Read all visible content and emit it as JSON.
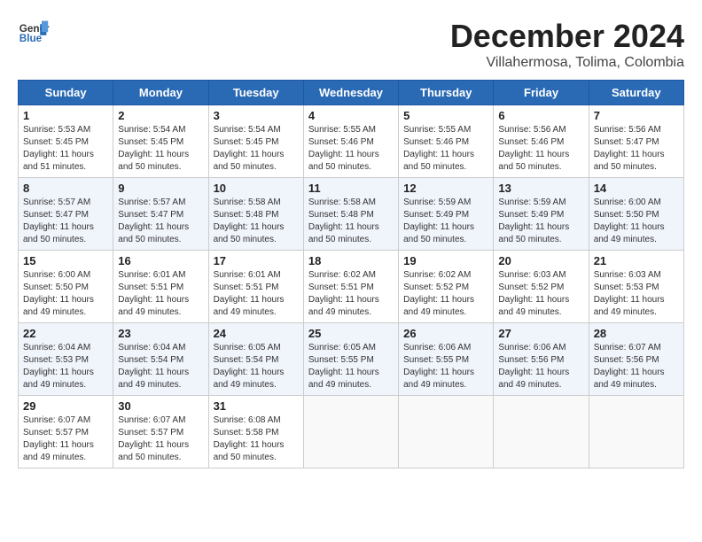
{
  "header": {
    "logo_line1": "General",
    "logo_line2": "Blue",
    "month": "December 2024",
    "location": "Villahermosa, Tolima, Colombia"
  },
  "days_of_week": [
    "Sunday",
    "Monday",
    "Tuesday",
    "Wednesday",
    "Thursday",
    "Friday",
    "Saturday"
  ],
  "weeks": [
    [
      {
        "day": 1,
        "info": "Sunrise: 5:53 AM\nSunset: 5:45 PM\nDaylight: 11 hours\nand 51 minutes."
      },
      {
        "day": 2,
        "info": "Sunrise: 5:54 AM\nSunset: 5:45 PM\nDaylight: 11 hours\nand 50 minutes."
      },
      {
        "day": 3,
        "info": "Sunrise: 5:54 AM\nSunset: 5:45 PM\nDaylight: 11 hours\nand 50 minutes."
      },
      {
        "day": 4,
        "info": "Sunrise: 5:55 AM\nSunset: 5:46 PM\nDaylight: 11 hours\nand 50 minutes."
      },
      {
        "day": 5,
        "info": "Sunrise: 5:55 AM\nSunset: 5:46 PM\nDaylight: 11 hours\nand 50 minutes."
      },
      {
        "day": 6,
        "info": "Sunrise: 5:56 AM\nSunset: 5:46 PM\nDaylight: 11 hours\nand 50 minutes."
      },
      {
        "day": 7,
        "info": "Sunrise: 5:56 AM\nSunset: 5:47 PM\nDaylight: 11 hours\nand 50 minutes."
      }
    ],
    [
      {
        "day": 8,
        "info": "Sunrise: 5:57 AM\nSunset: 5:47 PM\nDaylight: 11 hours\nand 50 minutes."
      },
      {
        "day": 9,
        "info": "Sunrise: 5:57 AM\nSunset: 5:47 PM\nDaylight: 11 hours\nand 50 minutes."
      },
      {
        "day": 10,
        "info": "Sunrise: 5:58 AM\nSunset: 5:48 PM\nDaylight: 11 hours\nand 50 minutes."
      },
      {
        "day": 11,
        "info": "Sunrise: 5:58 AM\nSunset: 5:48 PM\nDaylight: 11 hours\nand 50 minutes."
      },
      {
        "day": 12,
        "info": "Sunrise: 5:59 AM\nSunset: 5:49 PM\nDaylight: 11 hours\nand 50 minutes."
      },
      {
        "day": 13,
        "info": "Sunrise: 5:59 AM\nSunset: 5:49 PM\nDaylight: 11 hours\nand 50 minutes."
      },
      {
        "day": 14,
        "info": "Sunrise: 6:00 AM\nSunset: 5:50 PM\nDaylight: 11 hours\nand 49 minutes."
      }
    ],
    [
      {
        "day": 15,
        "info": "Sunrise: 6:00 AM\nSunset: 5:50 PM\nDaylight: 11 hours\nand 49 minutes."
      },
      {
        "day": 16,
        "info": "Sunrise: 6:01 AM\nSunset: 5:51 PM\nDaylight: 11 hours\nand 49 minutes."
      },
      {
        "day": 17,
        "info": "Sunrise: 6:01 AM\nSunset: 5:51 PM\nDaylight: 11 hours\nand 49 minutes."
      },
      {
        "day": 18,
        "info": "Sunrise: 6:02 AM\nSunset: 5:51 PM\nDaylight: 11 hours\nand 49 minutes."
      },
      {
        "day": 19,
        "info": "Sunrise: 6:02 AM\nSunset: 5:52 PM\nDaylight: 11 hours\nand 49 minutes."
      },
      {
        "day": 20,
        "info": "Sunrise: 6:03 AM\nSunset: 5:52 PM\nDaylight: 11 hours\nand 49 minutes."
      },
      {
        "day": 21,
        "info": "Sunrise: 6:03 AM\nSunset: 5:53 PM\nDaylight: 11 hours\nand 49 minutes."
      }
    ],
    [
      {
        "day": 22,
        "info": "Sunrise: 6:04 AM\nSunset: 5:53 PM\nDaylight: 11 hours\nand 49 minutes."
      },
      {
        "day": 23,
        "info": "Sunrise: 6:04 AM\nSunset: 5:54 PM\nDaylight: 11 hours\nand 49 minutes."
      },
      {
        "day": 24,
        "info": "Sunrise: 6:05 AM\nSunset: 5:54 PM\nDaylight: 11 hours\nand 49 minutes."
      },
      {
        "day": 25,
        "info": "Sunrise: 6:05 AM\nSunset: 5:55 PM\nDaylight: 11 hours\nand 49 minutes."
      },
      {
        "day": 26,
        "info": "Sunrise: 6:06 AM\nSunset: 5:55 PM\nDaylight: 11 hours\nand 49 minutes."
      },
      {
        "day": 27,
        "info": "Sunrise: 6:06 AM\nSunset: 5:56 PM\nDaylight: 11 hours\nand 49 minutes."
      },
      {
        "day": 28,
        "info": "Sunrise: 6:07 AM\nSunset: 5:56 PM\nDaylight: 11 hours\nand 49 minutes."
      }
    ],
    [
      {
        "day": 29,
        "info": "Sunrise: 6:07 AM\nSunset: 5:57 PM\nDaylight: 11 hours\nand 49 minutes."
      },
      {
        "day": 30,
        "info": "Sunrise: 6:07 AM\nSunset: 5:57 PM\nDaylight: 11 hours\nand 50 minutes."
      },
      {
        "day": 31,
        "info": "Sunrise: 6:08 AM\nSunset: 5:58 PM\nDaylight: 11 hours\nand 50 minutes."
      },
      null,
      null,
      null,
      null
    ]
  ]
}
